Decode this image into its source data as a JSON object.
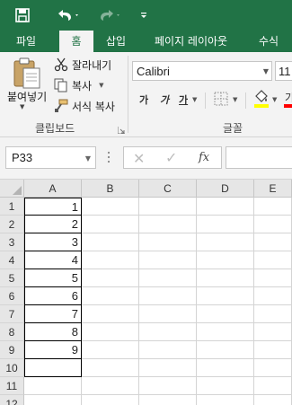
{
  "titlebar": {
    "save_icon": "save-icon",
    "undo_icon": "undo-icon",
    "redo_icon": "redo-icon",
    "customize_icon": "customize-qat-icon"
  },
  "tabs": {
    "file": "파일",
    "home": "홈",
    "insert": "삽입",
    "page_layout": "페이지 레이아웃",
    "formulas": "수식"
  },
  "ribbon": {
    "clipboard": {
      "paste": "붙여넣기",
      "cut": "잘라내기",
      "copy": "복사",
      "format_painter": "서식 복사",
      "group_label": "클립보드"
    },
    "font": {
      "font_name": "Calibri",
      "font_size": "11",
      "bold": "가",
      "italic": "가",
      "underline": "가",
      "group_label": "글꼴"
    }
  },
  "formula_bar": {
    "name_box": "P33",
    "cancel": "✕",
    "enter": "✓",
    "fx": "fx",
    "content": ""
  },
  "grid": {
    "columns": [
      "A",
      "B",
      "C",
      "D",
      "E"
    ],
    "rows": [
      {
        "num": "1",
        "a": "1"
      },
      {
        "num": "2",
        "a": "2"
      },
      {
        "num": "3",
        "a": "3"
      },
      {
        "num": "4",
        "a": "4"
      },
      {
        "num": "5",
        "a": "5"
      },
      {
        "num": "6",
        "a": "6"
      },
      {
        "num": "7",
        "a": "7"
      },
      {
        "num": "8",
        "a": "8"
      },
      {
        "num": "9",
        "a": "9"
      },
      {
        "num": "10",
        "a": ""
      },
      {
        "num": "11",
        "a": ""
      },
      {
        "num": "12",
        "a": ""
      }
    ]
  },
  "colors": {
    "accent": "#217346",
    "ribbon_bg": "#f3f3f3",
    "header_bg": "#e6e6e6"
  }
}
